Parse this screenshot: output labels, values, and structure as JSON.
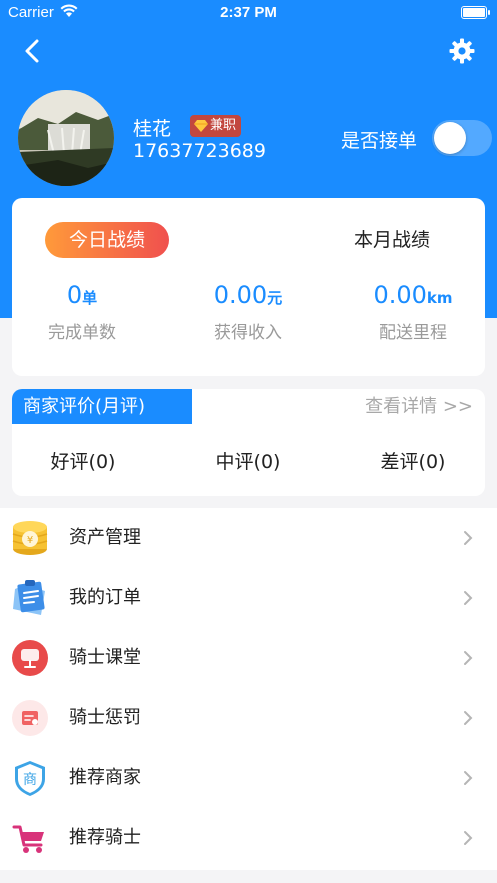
{
  "status_bar": {
    "carrier": "Carrier",
    "time": "2:37 PM"
  },
  "profile": {
    "name": "桂花",
    "badge": "兼职",
    "phone": "17637723689",
    "accept_orders_label": "是否接单",
    "accept_orders_on": false
  },
  "stats": {
    "tabs": {
      "today": "今日战绩",
      "month": "本月战绩"
    },
    "items": [
      {
        "value": "0",
        "unit": "单",
        "label": "完成单数"
      },
      {
        "value": "0.00",
        "unit": "元",
        "label": "获得收入"
      },
      {
        "value": "0.00",
        "unit": "km",
        "label": "配送里程"
      }
    ]
  },
  "reviews": {
    "title": "商家评价(月评)",
    "more": "查看详情 >>",
    "items": [
      {
        "label": "好评(0)"
      },
      {
        "label": "中评(0)"
      },
      {
        "label": "差评(0)"
      }
    ]
  },
  "menu": {
    "items": [
      {
        "label": "资产管理",
        "icon": "coin-stack-icon"
      },
      {
        "label": "我的订单",
        "icon": "order-list-icon"
      },
      {
        "label": "骑士课堂",
        "icon": "classroom-icon"
      },
      {
        "label": "骑士惩罚",
        "icon": "penalty-icon"
      },
      {
        "label": "推荐商家",
        "icon": "merchant-shield-icon"
      },
      {
        "label": "推荐骑士",
        "icon": "cart-icon"
      }
    ]
  },
  "colors": {
    "primary": "#1a8cff",
    "accent_gradient_start": "#ff9a3a",
    "accent_gradient_end": "#f0504e",
    "badge": "#c2473e"
  }
}
